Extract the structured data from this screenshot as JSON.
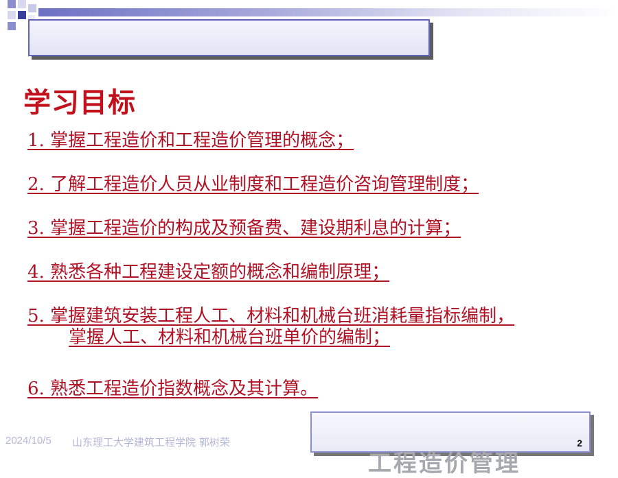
{
  "slide": {
    "title": "学习目标",
    "objectives": [
      {
        "text": "1. 掌握工程造价和工程造价管理的概念；"
      },
      {
        "text": "2. 了解工程造价人员从业制度和工程造价咨询管理制度；"
      },
      {
        "text": "3. 掌握工程造价的构成及预备费、建设期利息的计算；"
      },
      {
        "text": "4. 熟悉各种工程建设定额的概念和编制原理；"
      },
      {
        "text": "5. 掌握建筑安装工程人工、材料和机械台班消耗量指标编制，",
        "continuation": "掌握人工、材料和机械台班单价的编制；"
      },
      {
        "text": "6. 熟悉工程造价指数概念及其计算。"
      }
    ]
  },
  "footer": {
    "date": "2024/10/5",
    "author": "山东理工大学建筑工程学院   郭树荣",
    "page_number": "2",
    "course_title": "工程造价管理"
  },
  "colors": {
    "title": "#c0111c",
    "objective_text": "#b01225",
    "accent": "#5f63b8"
  }
}
